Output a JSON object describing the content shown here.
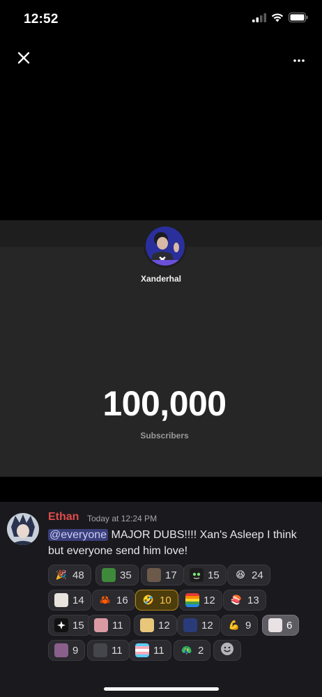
{
  "status_bar": {
    "time": "12:52"
  },
  "viewer": {
    "close_icon": "close-icon",
    "more_icon": "more-horizontal-icon"
  },
  "image": {
    "creator_name": "Xanderhal",
    "subscriber_count": "100,000",
    "subscriber_label": "Subscribers"
  },
  "message": {
    "author": "Ethan",
    "author_color": "#e24b4b",
    "timestamp": "Today at 12:24 PM",
    "mention": "@everyone",
    "text": " MAJOR DUBS!!!! Xan's Asleep I think but everyone send him love!"
  },
  "reactions": [
    {
      "emoji": "party-popper",
      "count": "48"
    },
    {
      "emoji": "pepe-frog",
      "count": "35"
    },
    {
      "emoji": "custom-emote-1",
      "count": "17"
    },
    {
      "emoji": "alien-face",
      "count": "15"
    },
    {
      "emoji": "laughing-face",
      "count": "24"
    },
    {
      "emoji": "anime-cat",
      "count": "14"
    },
    {
      "emoji": "crab",
      "count": "16"
    },
    {
      "emoji": "rofl-face",
      "count": "10",
      "state": "active"
    },
    {
      "emoji": "pride-flag",
      "count": "12"
    },
    {
      "emoji": "sushi",
      "count": "13"
    },
    {
      "emoji": "star-logo",
      "count": "15"
    },
    {
      "emoji": "pink-anime",
      "count": "11"
    },
    {
      "emoji": "blonde-anime",
      "count": "12"
    },
    {
      "emoji": "blue-character",
      "count": "12"
    },
    {
      "emoji": "flexed-biceps",
      "count": "9"
    },
    {
      "emoji": "manga-panel",
      "count": "6",
      "state": "selected"
    },
    {
      "emoji": "purple-girl",
      "count": "9"
    },
    {
      "emoji": "dark-figure",
      "count": "11"
    },
    {
      "emoji": "trans-flag",
      "count": "11"
    },
    {
      "emoji": "peacock",
      "count": "2"
    }
  ],
  "add_reaction_icon": "add-reaction-icon"
}
